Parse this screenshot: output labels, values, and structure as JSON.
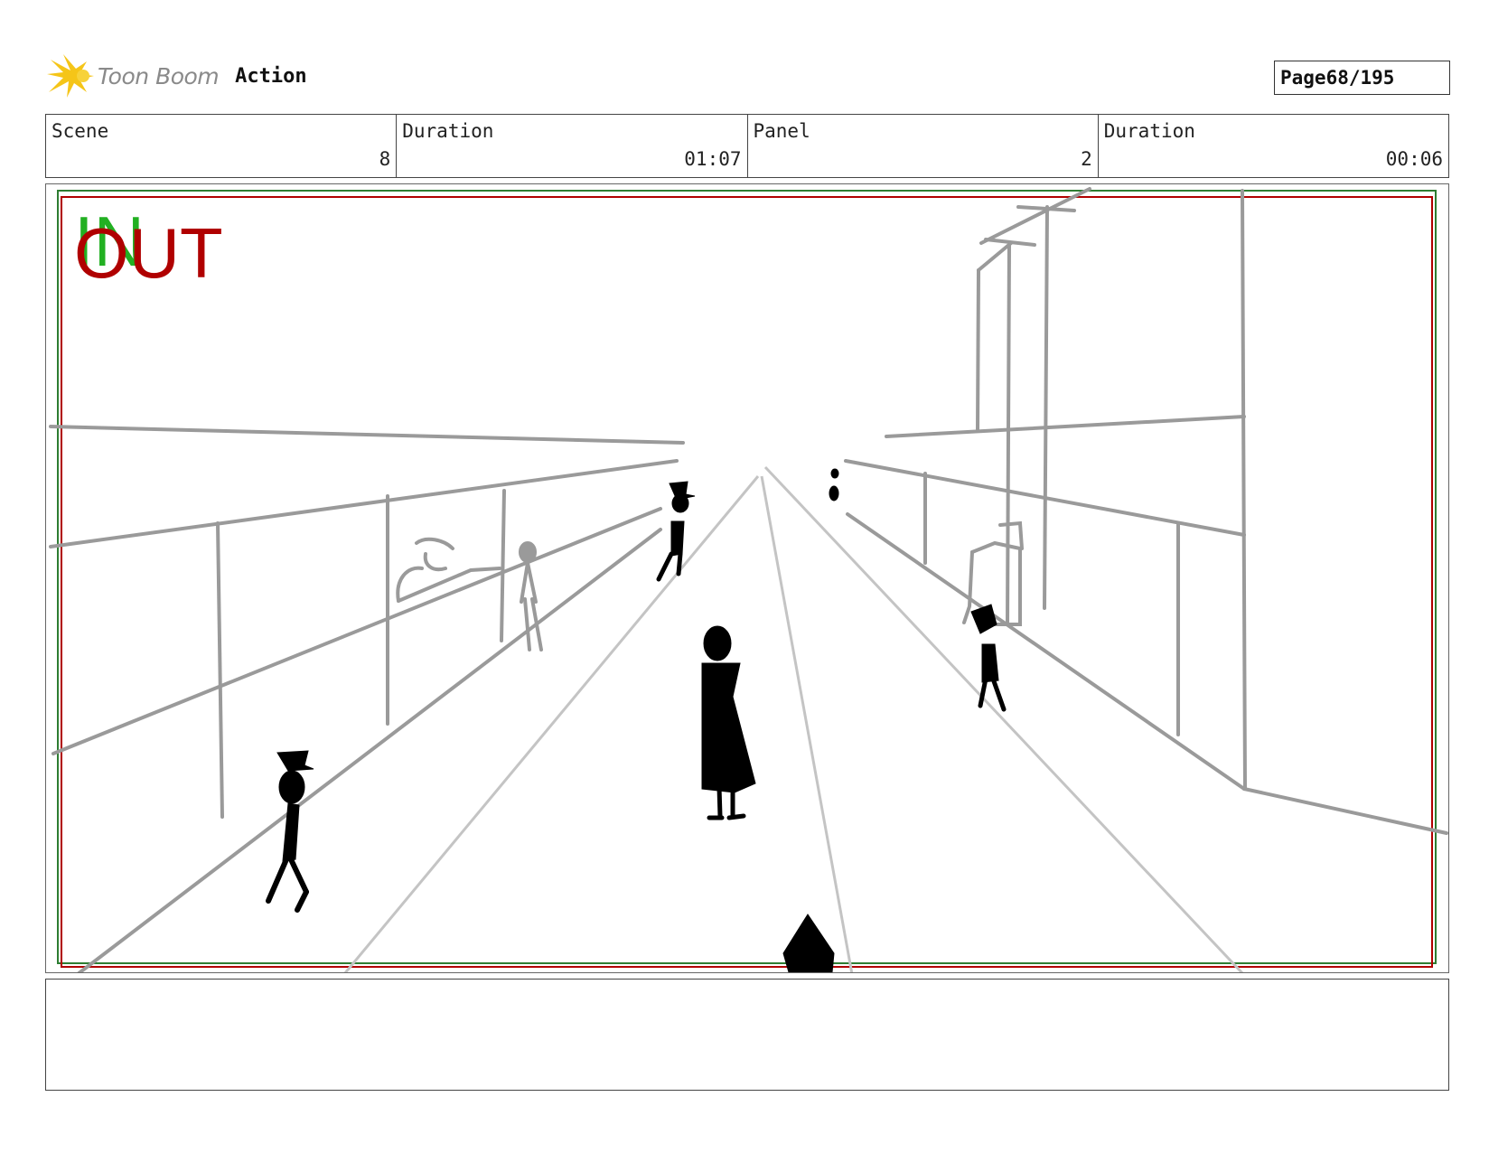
{
  "header": {
    "brand": "Toon Boom",
    "product": "Action",
    "page_label": "Page",
    "page_value": "68/195"
  },
  "info": {
    "scene_label": "Scene",
    "scene_value": "8",
    "scene_duration_label": "Duration",
    "scene_duration_value": "01:07",
    "panel_label": "Panel",
    "panel_value": "2",
    "panel_duration_label": "Duration",
    "panel_duration_value": "00:06"
  },
  "panel": {
    "in_marker": "IN",
    "out_marker": "OUT",
    "colors": {
      "in": "#22b022",
      "out": "#b00000",
      "sketch_gray": "#9a9a9a",
      "figure": "#000000"
    }
  },
  "caption": {
    "text": ""
  }
}
